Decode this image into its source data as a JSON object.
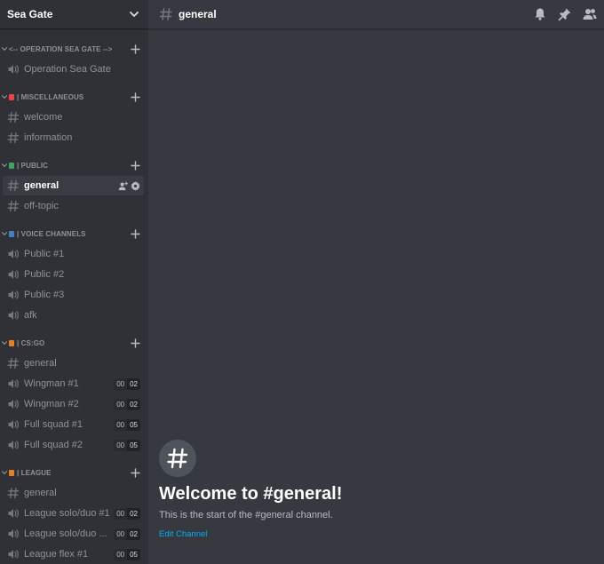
{
  "server": {
    "name": "Sea Gate"
  },
  "colors": {
    "red": "#ed4245",
    "green": "#3ba55d",
    "blue": "#3b82c4",
    "orange": "#e67e22",
    "link": "#00b0f4"
  },
  "categories": [
    {
      "name": "<-- OPERATION SEA GATE -->",
      "box_color": "",
      "channels": [
        {
          "type": "voice",
          "name": "Operation Sea Gate"
        }
      ]
    },
    {
      "name": "| MISCELLANEOUS",
      "box_color": "#ed4245",
      "channels": [
        {
          "type": "text",
          "name": "welcome"
        },
        {
          "type": "text",
          "name": "information"
        }
      ]
    },
    {
      "name": "| PUBLIC",
      "box_color": "#3ba55d",
      "channels": [
        {
          "type": "text",
          "name": "general",
          "selected": true
        },
        {
          "type": "text",
          "name": "off-topic"
        }
      ]
    },
    {
      "name": "| VOICE CHANNELS",
      "box_color": "#3b82c4",
      "channels": [
        {
          "type": "voice",
          "name": "Public #1"
        },
        {
          "type": "voice",
          "name": "Public #2"
        },
        {
          "type": "voice",
          "name": "Public #3"
        },
        {
          "type": "voice",
          "name": "afk"
        }
      ]
    },
    {
      "name": "| CS:GO",
      "box_color": "#e67e22",
      "channels": [
        {
          "type": "text",
          "name": "general"
        },
        {
          "type": "voice",
          "name": "Wingman #1",
          "count": "00",
          "limit": "02"
        },
        {
          "type": "voice",
          "name": "Wingman #2",
          "count": "00",
          "limit": "02"
        },
        {
          "type": "voice",
          "name": "Full squad #1",
          "count": "00",
          "limit": "05"
        },
        {
          "type": "voice",
          "name": "Full squad #2",
          "count": "00",
          "limit": "05"
        }
      ]
    },
    {
      "name": "| LEAGUE",
      "box_color": "#e67e22",
      "channels": [
        {
          "type": "text",
          "name": "general"
        },
        {
          "type": "voice",
          "name": "League solo/duo #1",
          "count": "00",
          "limit": "02"
        },
        {
          "type": "voice",
          "name": "League solo/duo ...",
          "count": "00",
          "limit": "02"
        },
        {
          "type": "voice",
          "name": "League flex #1",
          "count": "00",
          "limit": "05"
        }
      ]
    }
  ],
  "header": {
    "channel_name": "general"
  },
  "welcome": {
    "title": "Welcome to #general!",
    "subtitle": "This is the start of the #general channel.",
    "edit_label": "Edit Channel"
  },
  "icons": {
    "server_menu": "chevron-down-icon",
    "hash": "hash-icon",
    "voice": "speaker-icon",
    "add": "plus-icon",
    "invite": "add-user-icon",
    "settings": "gear-icon",
    "bell": "bell-icon",
    "pin": "pin-icon",
    "members": "members-icon"
  }
}
